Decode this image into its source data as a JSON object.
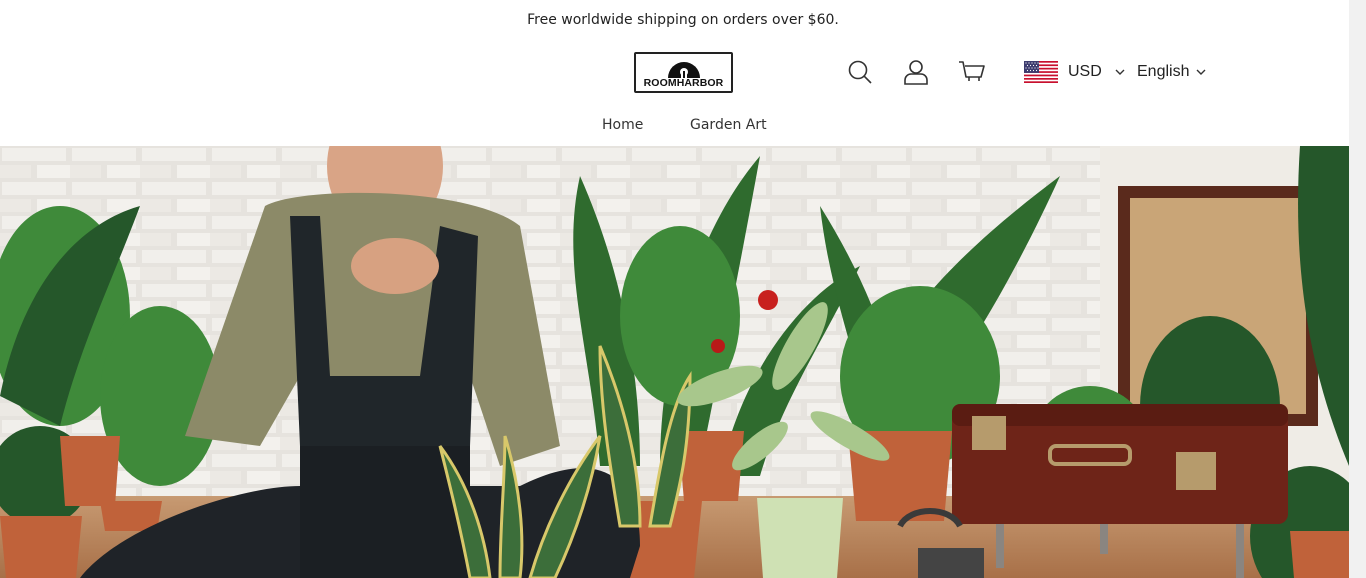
{
  "announcement": "Free worldwide shipping on orders over $60.",
  "brand": {
    "logo_text": "ROOMHARBOR"
  },
  "header": {
    "icons": [
      "search-icon",
      "account-icon",
      "cart-icon"
    ],
    "currency": {
      "label": "USD",
      "flag": "us-flag"
    },
    "language": {
      "label": "English"
    }
  },
  "nav": {
    "items": [
      {
        "label": "Home"
      },
      {
        "label": "Garden Art"
      }
    ]
  },
  "colors": {
    "text": "#222222",
    "wall": "#e4e1dc",
    "leaf": "#2f6b2e",
    "pot": "#c0623a",
    "floor": "#b07a52"
  }
}
